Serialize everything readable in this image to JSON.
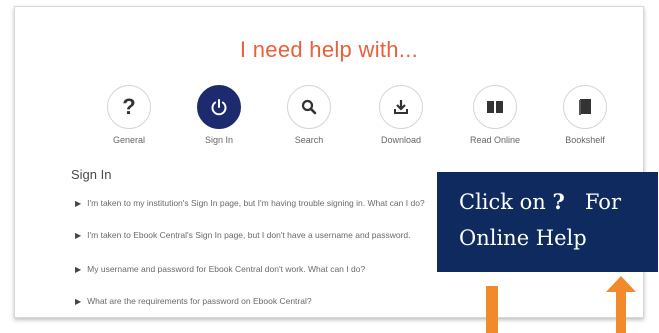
{
  "help": {
    "title": "I need help with...",
    "categories": [
      {
        "label": "General",
        "icon": "question-mark-icon",
        "active": false
      },
      {
        "label": "Sign In",
        "icon": "power-icon",
        "active": true
      },
      {
        "label": "Search",
        "icon": "search-icon",
        "active": false
      },
      {
        "label": "Download",
        "icon": "download-icon",
        "active": false
      },
      {
        "label": "Read Online",
        "icon": "open-book-icon",
        "active": false
      },
      {
        "label": "Bookshelf",
        "icon": "book-icon",
        "active": false
      }
    ],
    "section_title": "Sign In",
    "faqs": [
      "I'm taken to my institution's Sign In page, but I'm having trouble signing in. What can I do?",
      "I'm taken to Ebook Central's Sign In page, but I don't have a username and password.",
      "My username and password for Ebook Central don't work. What can I do?",
      "What are the requirements for password on Ebook Central?"
    ]
  },
  "callout": {
    "line1_prefix": "Click on",
    "line1_symbol": "?",
    "line1_suffix": "For",
    "line2": "Online Help"
  },
  "colors": {
    "title": "#e8613c",
    "active_circle": "#1d2a6e",
    "callout_bg": "#0e2a5e",
    "arrow": "#f08a2a"
  }
}
